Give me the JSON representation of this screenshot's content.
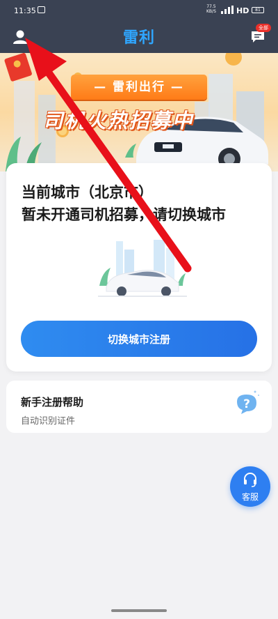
{
  "status_bar": {
    "time": "11:35",
    "speed_value": "77.5",
    "speed_unit": "KB/S",
    "network": "HD",
    "battery": "81"
  },
  "header": {
    "app_logo": "雷利",
    "message_badge": "全部"
  },
  "banner": {
    "tag": "— 雷利出行 —",
    "headline": "司机火热招募中"
  },
  "city_card": {
    "line1": "当前城市（北京市）",
    "line2": "暂未开通司机招募，请切换城市",
    "register_button": "切换城市注册"
  },
  "help_card": {
    "title": "新手注册帮助",
    "subtitle": "自动识别证件"
  },
  "service_button": {
    "label": "客服"
  },
  "colors": {
    "header_bg": "#3a4253",
    "accent_blue": "#2f8cf0",
    "banner_orange": "#ff7b17",
    "arrow_red": "#e8101a"
  },
  "icons": {
    "avatar": "user-icon",
    "message": "message-icon",
    "help": "question-bubble-icon",
    "service": "headset-icon"
  }
}
